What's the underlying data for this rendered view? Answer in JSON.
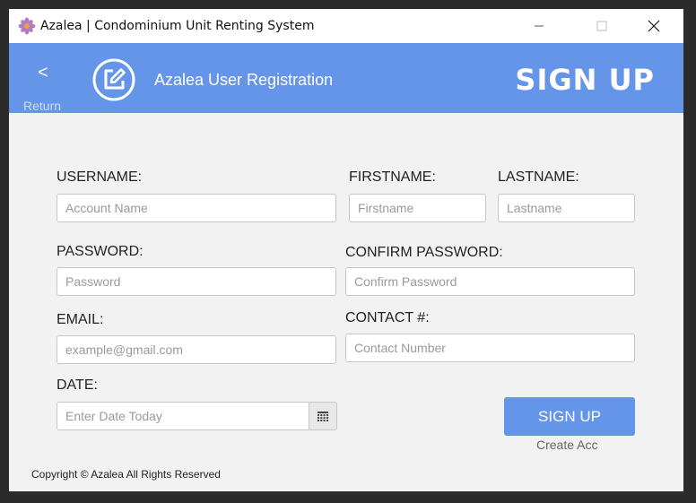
{
  "window": {
    "title": "Azalea | Condominium Unit Renting System"
  },
  "header": {
    "back_arrow": "<",
    "back_label": "Return",
    "title": "Azalea User Registration",
    "big_title": "SIGN UP"
  },
  "form": {
    "username_label": "USERNAME:",
    "username_placeholder": "Account Name",
    "firstname_label": "FIRSTNAME:",
    "firstname_placeholder": "Firstname",
    "lastname_label": "LASTNAME:",
    "lastname_placeholder": "Lastname",
    "password_label": "PASSWORD:",
    "password_placeholder": "Password",
    "confirm_label": "CONFIRM PASSWORD:",
    "confirm_placeholder": "Confirm Password",
    "email_label": "EMAIL:",
    "email_placeholder": "example@gmail.com",
    "contact_label": "CONTACT #:",
    "contact_placeholder": "Contact Number",
    "date_label": "DATE:",
    "date_placeholder": "Enter Date Today"
  },
  "actions": {
    "signup_label": "SIGN UP",
    "create_acc_label": "Create Acc"
  },
  "footer": {
    "copyright": "Copyright © Azalea All Rights Reserved"
  },
  "colors": {
    "accent": "#6495e8",
    "background": "#f2f2f2"
  },
  "icons": {
    "app": "azalea-flower-icon",
    "edit": "edit-square-icon",
    "calendar": "calendar-icon"
  }
}
